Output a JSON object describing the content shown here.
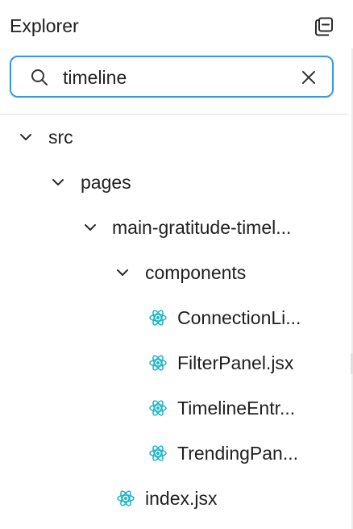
{
  "header": {
    "title": "Explorer",
    "collapse_icon": "collapse-all-icon"
  },
  "search": {
    "value": "timeline",
    "placeholder": "",
    "search_icon": "search-icon",
    "clear_icon": "close-icon"
  },
  "colors": {
    "focus_border": "#3a9ad9",
    "react_icon": "#1bb5c9",
    "text": "#1f1f1f",
    "divider": "#dedede"
  },
  "tree": {
    "src": {
      "label": "src",
      "expanded": true,
      "icon": "chevron-down-icon"
    },
    "pages": {
      "label": "pages",
      "expanded": true,
      "icon": "chevron-down-icon"
    },
    "main_folder": {
      "label": "main-gratitude-timel...",
      "expanded": true,
      "icon": "chevron-down-icon"
    },
    "components": {
      "label": "components",
      "expanded": true,
      "icon": "chevron-down-icon"
    },
    "files": [
      {
        "label": "ConnectionLi...",
        "icon": "react-icon"
      },
      {
        "label": "FilterPanel.jsx",
        "icon": "react-icon"
      },
      {
        "label": "TimelineEntr...",
        "icon": "react-icon"
      },
      {
        "label": "TrendingPan...",
        "icon": "react-icon"
      }
    ],
    "index": {
      "label": "index.jsx",
      "icon": "react-icon"
    }
  }
}
